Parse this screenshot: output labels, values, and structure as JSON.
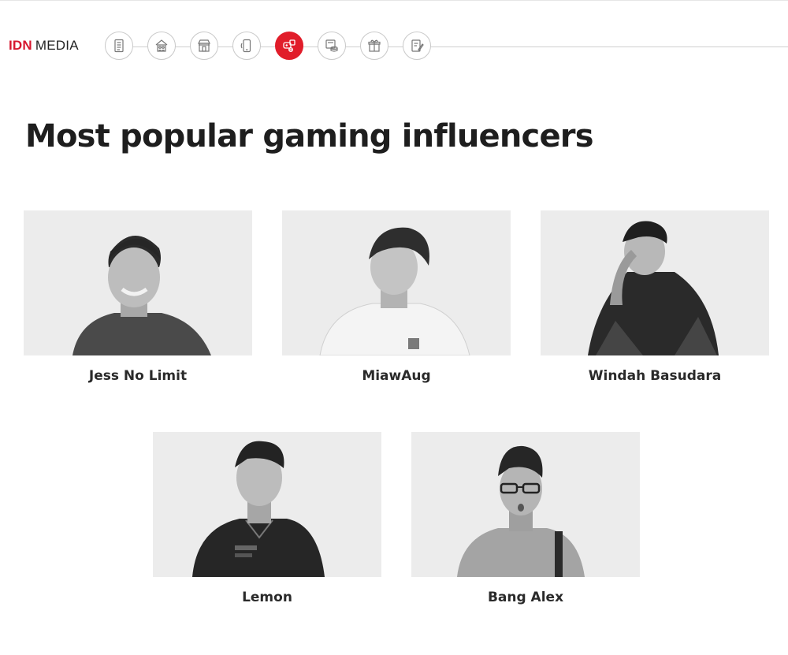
{
  "brand": {
    "idn": "IDN",
    "media": "MEDIA",
    "accent": "#e11d2a"
  },
  "nav": {
    "steps": [
      {
        "icon": "document-list-icon",
        "active": false
      },
      {
        "icon": "house-people-icon",
        "active": false
      },
      {
        "icon": "shop-icon",
        "active": false
      },
      {
        "icon": "smartphone-icon",
        "active": false
      },
      {
        "icon": "gamepad-icon",
        "active": true
      },
      {
        "icon": "coins-icon",
        "active": false
      },
      {
        "icon": "gift-icon",
        "active": false
      },
      {
        "icon": "notepad-icon",
        "active": false
      }
    ]
  },
  "page": {
    "title": "Most popular gaming influencers"
  },
  "influencers": [
    {
      "name": "Jess No Limit"
    },
    {
      "name": "MiawAug"
    },
    {
      "name": "Windah Basudara"
    },
    {
      "name": "Lemon"
    },
    {
      "name": "Bang Alex"
    }
  ]
}
